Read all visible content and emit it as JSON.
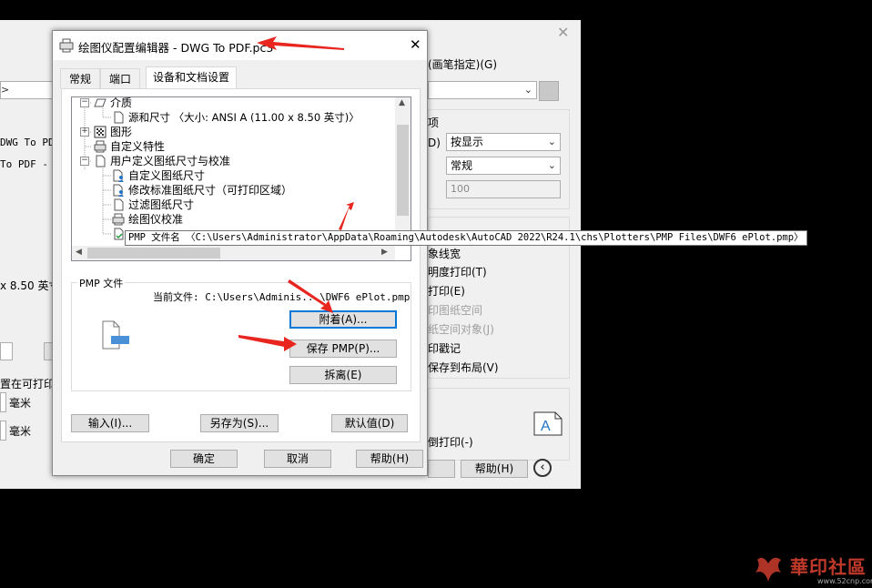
{
  "background": {
    "pen_assign_label": "(画笔指定)(G)",
    "group_label": "项",
    "shade_label": "D)",
    "shade_value": "按显示",
    "quality_value": "常规",
    "dpi_value": "100",
    "left_text_1": "DWG To PDF",
    "left_text_2": "To PDF - ",
    "paper_size": "x 8.50 英寸",
    "fit_label": "置在可打印",
    "unit_1": "毫米",
    "unit_2": "毫米",
    "options": [
      "象线宽",
      "明度打印(T)",
      "打印(E)",
      "印图纸空间",
      "纸空间对象(J)",
      "印戳记",
      "保存到布局(V)"
    ],
    "upside_down": "倒打印(-)",
    "help_button": "帮助(H)"
  },
  "dialog": {
    "title": "绘图仪配置编辑器 - DWG To PDF.pc3",
    "tabs": [
      "常规",
      "端口",
      "设备和文档设置"
    ],
    "active_tab": 2,
    "tree": [
      {
        "label": "介质",
        "level": 0
      },
      {
        "label": "源和尺寸 〈大小: ANSI A (11.00 x 8.50 英寸)〉",
        "level": 1
      },
      {
        "label": "图形",
        "level": 0
      },
      {
        "label": "自定义特性",
        "level": 0
      },
      {
        "label": "用户定义图纸尺寸与校准",
        "level": 0
      },
      {
        "label": "自定义图纸尺寸",
        "level": 1
      },
      {
        "label": "修改标准图纸尺寸（可打印区域）",
        "level": 1
      },
      {
        "label": "过滤图纸尺寸",
        "level": 1
      },
      {
        "label": "绘图仪校准",
        "level": 1
      },
      {
        "label": "PMP 文件名 〈C:\\Users\\Administrator\\AppData\\Roaming\\Autodesk\\AutoCAD 2022\\R24.1\\chs\\Plotters\\PMP Files\\DWF6 ePlot.pmp〉",
        "level": 1
      }
    ],
    "pmp_group": "PMP 文件",
    "current_file_label": "当前文件: C:\\Users\\Adminis...\\DWF6 ePlot.pmp",
    "buttons": {
      "attach": "附着(A)...",
      "save_pmp": "保存 PMP(P)...",
      "detach": "拆离(E)",
      "import": "输入(I)...",
      "save_as": "另存为(S)...",
      "defaults": "默认值(D)",
      "ok": "确定",
      "cancel": "取消",
      "help": "帮助(H)"
    }
  },
  "watermark": {
    "text": "華印社區",
    "url": "www.52cnp.com"
  },
  "colors": {
    "arrow": "#e8251e",
    "accent": "#0078d7"
  }
}
